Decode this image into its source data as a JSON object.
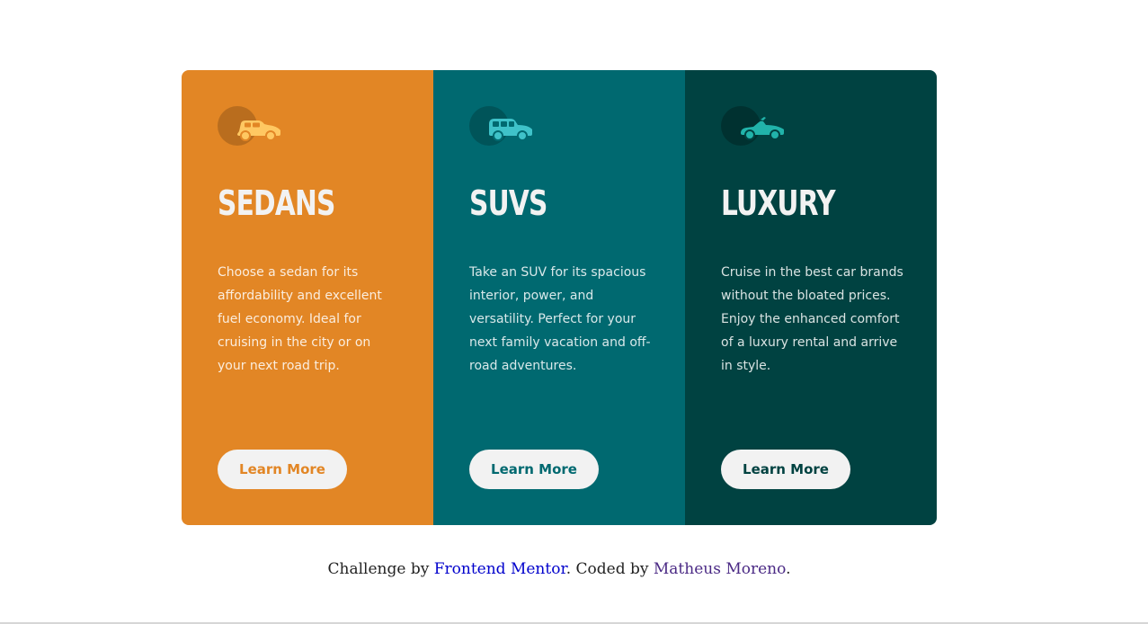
{
  "cards": [
    {
      "icon": "sedan-car-icon",
      "title": "SEDANS",
      "text": "Choose a sedan for its affordability and excellent fuel economy. Ideal for cruising in the city or on your next road trip.",
      "button": "Learn More",
      "color": "#e28625"
    },
    {
      "icon": "suv-car-icon",
      "title": "SUVS",
      "text": "Take an SUV for its spacious interior, power, and versatility. Perfect for your next family vacation and off-road adventures.",
      "button": "Learn More",
      "color": "#006970"
    },
    {
      "icon": "luxury-car-icon",
      "title": "LUXURY",
      "text": "Cruise in the best car brands without the bloated prices. Enjoy the enhanced comfort of a luxury rental and arrive in style.",
      "button": "Learn More",
      "color": "#004241"
    }
  ],
  "attribution": {
    "prefix": "Challenge by ",
    "link1": "Frontend Mentor",
    "middle": ". Coded by ",
    "link2": "Matheus Moreno",
    "suffix": "."
  },
  "colors": {
    "button_bg": "#f2f2f2",
    "heading": "#f2f2f2"
  }
}
